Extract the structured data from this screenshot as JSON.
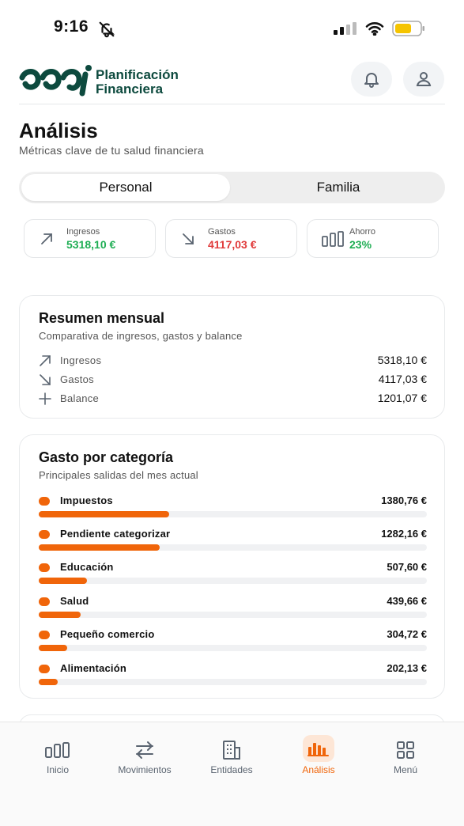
{
  "status": {
    "time": "9:16"
  },
  "brand": {
    "line1": "Planificación",
    "line2": "Financiera",
    "color": "#0d4a3e"
  },
  "page": {
    "title": "Análisis",
    "subtitle": "Métricas clave de tu salud financiera"
  },
  "segments": {
    "personal": "Personal",
    "familia": "Familia",
    "selected": "Personal"
  },
  "kpis": {
    "ingresos": {
      "label": "Ingresos",
      "value": "5318,10 €"
    },
    "gastos": {
      "label": "Gastos",
      "value": "4117,03 €"
    },
    "ahorro": {
      "label": "Ahorro",
      "value": "23%"
    }
  },
  "resumen": {
    "title": "Resumen mensual",
    "subtitle": "Comparativa de ingresos, gastos y balance",
    "rows": [
      {
        "label": "Ingresos",
        "value": "5318,10 €",
        "icon": "arrow-up-right-icon"
      },
      {
        "label": "Gastos",
        "value": "4117,03 €",
        "icon": "arrow-down-right-icon"
      },
      {
        "label": "Balance",
        "value": "1201,07 €",
        "icon": "plus-icon"
      }
    ]
  },
  "categorias": {
    "title": "Gasto por categoría",
    "subtitle": "Principales salidas del mes actual",
    "accent": "#f0650a",
    "items": [
      {
        "name": "Impuestos",
        "value": "1380,76 €",
        "fraction": 0.336
      },
      {
        "name": "Pendiente categorizar",
        "value": "1282,16 €",
        "fraction": 0.312
      },
      {
        "name": "Educación",
        "value": "507,60 €",
        "fraction": 0.124
      },
      {
        "name": "Salud",
        "value": "439,66 €",
        "fraction": 0.107
      },
      {
        "name": "Pequeño comercio",
        "value": "304,72 €",
        "fraction": 0.074
      },
      {
        "name": "Alimentación",
        "value": "202,13 €",
        "fraction": 0.049
      }
    ]
  },
  "nav": {
    "inicio": "Inicio",
    "movimientos": "Movimientos",
    "entidades": "Entidades",
    "analisis": "Análisis",
    "menu": "Menú",
    "active": "Análisis"
  }
}
